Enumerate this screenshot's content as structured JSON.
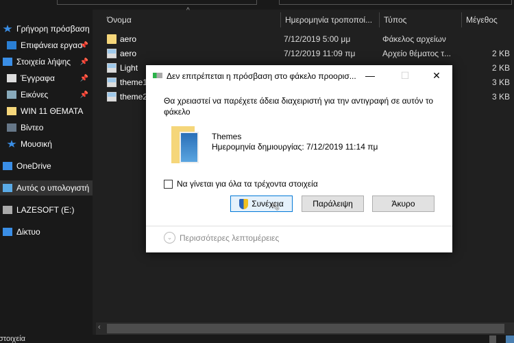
{
  "sidebar": {
    "items": [
      {
        "label": "Γρήγορη πρόσβαση",
        "icon": "star-icon",
        "pinned": false
      },
      {
        "label": "Επιφάνεια εργασ",
        "icon": "desktop-icon",
        "pinned": true
      },
      {
        "label": "Στοιχεία λήψης",
        "icon": "download-icon",
        "pinned": true
      },
      {
        "label": "Έγγραφα",
        "icon": "documents-icon",
        "pinned": true
      },
      {
        "label": "Εικόνες",
        "icon": "pictures-icon",
        "pinned": true
      },
      {
        "label": "WIN 11 ΘΕΜΑΤΑ",
        "icon": "folder-icon",
        "pinned": false
      },
      {
        "label": "Βίντεο",
        "icon": "video-icon",
        "pinned": false
      },
      {
        "label": "Μουσική",
        "icon": "music-icon",
        "pinned": false
      },
      {
        "label": "OneDrive",
        "icon": "cloud-icon",
        "pinned": false
      },
      {
        "label": "Αυτός ο υπολογιστή",
        "icon": "computer-icon",
        "pinned": false,
        "selected": true
      },
      {
        "label": "LAZESOFT (E:)",
        "icon": "drive-icon",
        "pinned": false
      },
      {
        "label": "Δίκτυο",
        "icon": "network-icon",
        "pinned": false
      }
    ]
  },
  "columns": {
    "name": "Όνομα",
    "date": "Ημερομηνία τροποποί...",
    "type": "Τύπος",
    "size": "Μέγεθος"
  },
  "files": [
    {
      "name": "aero",
      "date": "7/12/2019 5:00 μμ",
      "type": "Φάκελος αρχείων",
      "size": "",
      "kind": "folder"
    },
    {
      "name": "aero",
      "date": "7/12/2019 11:09 πμ",
      "type": "Αρχείο θέματος τ...",
      "size": "2 KB",
      "kind": "theme"
    },
    {
      "name": "Light",
      "date": "",
      "type": "",
      "size": "2 KB",
      "kind": "theme"
    },
    {
      "name": "theme1",
      "date": "",
      "type": "",
      "size": "3 KB",
      "kind": "theme"
    },
    {
      "name": "theme2",
      "date": "",
      "type": "",
      "size": "3 KB",
      "kind": "theme"
    }
  ],
  "status": {
    "text": "στοιχεία"
  },
  "dialog": {
    "title": "Δεν επιτρέπεται η πρόσβαση στο φάκελο προορισ...",
    "message": "Θα χρειαστεί να παρέχετε άδεια διαχειριστή για την αντιγραφή σε αυτόν το φάκελο",
    "folder_name": "Themes",
    "created": "Ημερομηνία δημιουργίας: 7/12/2019 11:14 πμ",
    "checkbox_label": "Να γίνεται για όλα τα τρέχοντα στοιχεία",
    "checkbox_checked": false,
    "continue_label": "Συνέχεια",
    "skip_label": "Παράλειψη",
    "cancel_label": "Άκυρο",
    "more_details": "Περισσότερες λεπτομέρειες"
  }
}
